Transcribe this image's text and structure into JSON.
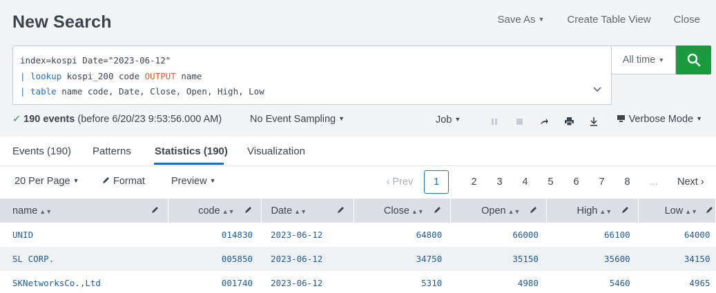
{
  "header": {
    "title": "New Search",
    "save_as": "Save As",
    "create_table_view": "Create Table View",
    "close": "Close"
  },
  "search": {
    "line1": "index=kospi Date=\"2023-06-12\"",
    "line2_pipe": "| ",
    "line2_cmd": "lookup",
    "line2_mid": " kospi_200 code ",
    "line2_kw": "OUTPUT",
    "line2_end": " name",
    "line3_pipe": "| ",
    "line3_cmd": "table",
    "line3_end": " name code, Date, Close, Open, High, Low",
    "time_range": "All time"
  },
  "status": {
    "count": "190 events",
    "before": "(before 6/20/23 9:53:56.000 AM)",
    "sampling": "No Event Sampling",
    "job": "Job",
    "mode": "Verbose Mode"
  },
  "tabs": [
    {
      "label": "Events (190)"
    },
    {
      "label": "Patterns"
    },
    {
      "label": "Statistics (190)"
    },
    {
      "label": "Visualization"
    }
  ],
  "toolbar": {
    "per_page": "20 Per Page",
    "format": "Format",
    "preview": "Preview"
  },
  "pager": {
    "prev": "Prev",
    "pages": [
      "1",
      "2",
      "3",
      "4",
      "5",
      "6",
      "7",
      "8"
    ],
    "current": "1",
    "ellipsis": "...",
    "next": "Next"
  },
  "table": {
    "headers": [
      "name",
      "code",
      "Date",
      "Close",
      "Open",
      "High",
      "Low"
    ],
    "rows": [
      [
        "UNID",
        "014830",
        "2023-06-12",
        "64800",
        "66000",
        "66100",
        "64000"
      ],
      [
        "SL CORP.",
        "005850",
        "2023-06-12",
        "34750",
        "35150",
        "35600",
        "34150"
      ],
      [
        "SKNetworksCo.,Ltd",
        "001740",
        "2023-06-12",
        "5310",
        "4980",
        "5460",
        "4965"
      ]
    ]
  },
  "colors": {
    "accent": "#1a6ec8",
    "search_button": "#1a9c3e",
    "keyword_orange": "#e35d23"
  },
  "icons": [
    "search-icon",
    "chevron-down-icon",
    "check-icon",
    "pause-icon",
    "stop-icon",
    "share-icon",
    "print-icon",
    "download-icon",
    "verbose-mode-icon",
    "pencil-icon",
    "sort-icon",
    "chevron-left-icon",
    "chevron-right-icon"
  ]
}
